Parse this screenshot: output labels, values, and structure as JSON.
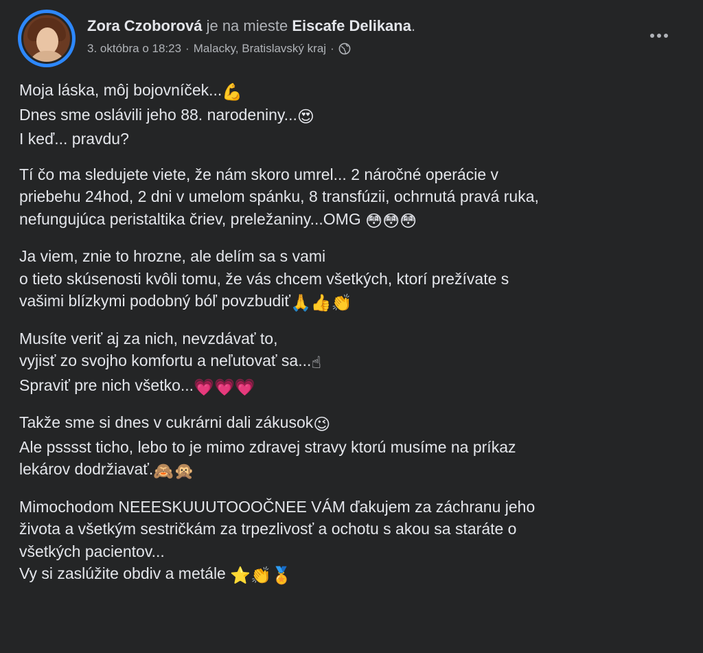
{
  "post": {
    "author": "Zora Czoborová",
    "connector": " je na mieste ",
    "place": "Eiscafe Delikana",
    "period": ".",
    "date": "3. októbra o 18:23",
    "separator": "·",
    "location": "Malacky, Bratislavský kraj",
    "separator2": "·",
    "privacy_icon": "globe-icon",
    "more_icon": "more-options-icon"
  },
  "paragraphs": [
    {
      "lines": [
        {
          "text": "Moja láska, môj  bojovníček...",
          "emoji": "💪"
        },
        {
          "text": "Dnes sme oslávili jeho 88. narodeniny...",
          "emoji": "😍"
        },
        {
          "text": "I keď... pravdu?",
          "emoji": ""
        }
      ]
    },
    {
      "lines": [
        {
          "text": "Tí čo ma sledujete viete, že nám skoro umrel... 2 náročné operácie v",
          "emoji": ""
        },
        {
          "text": "priebehu 24hod, 2 dni v umelom spánku, 8 transfúzii,  ochrnutá pravá ruka,",
          "emoji": ""
        },
        {
          "text": "nefungujúca peristaltika čriev, preležaniny...OMG ",
          "emoji": "😳😳😳"
        }
      ]
    },
    {
      "lines": [
        {
          "text": "Ja viem, znie to hrozne, ale delím sa s vami",
          "emoji": ""
        },
        {
          "text": "o tieto skúsenosti kvôli tomu, že vás chcem všetkých, ktorí prežívate s",
          "emoji": ""
        },
        {
          "text": "vašimi blízkymi podobný bóľ povzbudiť",
          "emoji": "🙏👍👏"
        }
      ]
    },
    {
      "lines": [
        {
          "text": "Musíte veriť aj za nich, nevzdávať to,",
          "emoji": ""
        },
        {
          "text": "vyjisť zo svojho komfortu a neľutovať sa...",
          "emoji": "☝"
        },
        {
          "text": "Spraviť pre nich všetko...",
          "emoji": "💗💗💗"
        }
      ]
    },
    {
      "lines": [
        {
          "text": "Takže sme si dnes v cukrárni dali zákusok",
          "emoji": "😉"
        },
        {
          "text": "Ale psssst ticho,  lebo to je mimo zdravej stravy ktorú musíme na príkaz",
          "emoji": ""
        },
        {
          "text": "lekárov dodržiavať.",
          "emoji": "🙈🙊"
        }
      ]
    },
    {
      "lines": [
        {
          "text": "Mimochodom NEEESKUUUTOOOČNEE VÁM  ďakujem za záchranu jeho",
          "emoji": ""
        },
        {
          "text": "života a všetkým sestričkám za trpezlivosť a ochotu s akou sa staráte  o",
          "emoji": ""
        },
        {
          "text": "všetkých pacientov...",
          "emoji": ""
        },
        {
          "text": "Vy si zaslúžite obdiv a metále ",
          "emoji": "⭐👏🏅"
        }
      ]
    }
  ]
}
